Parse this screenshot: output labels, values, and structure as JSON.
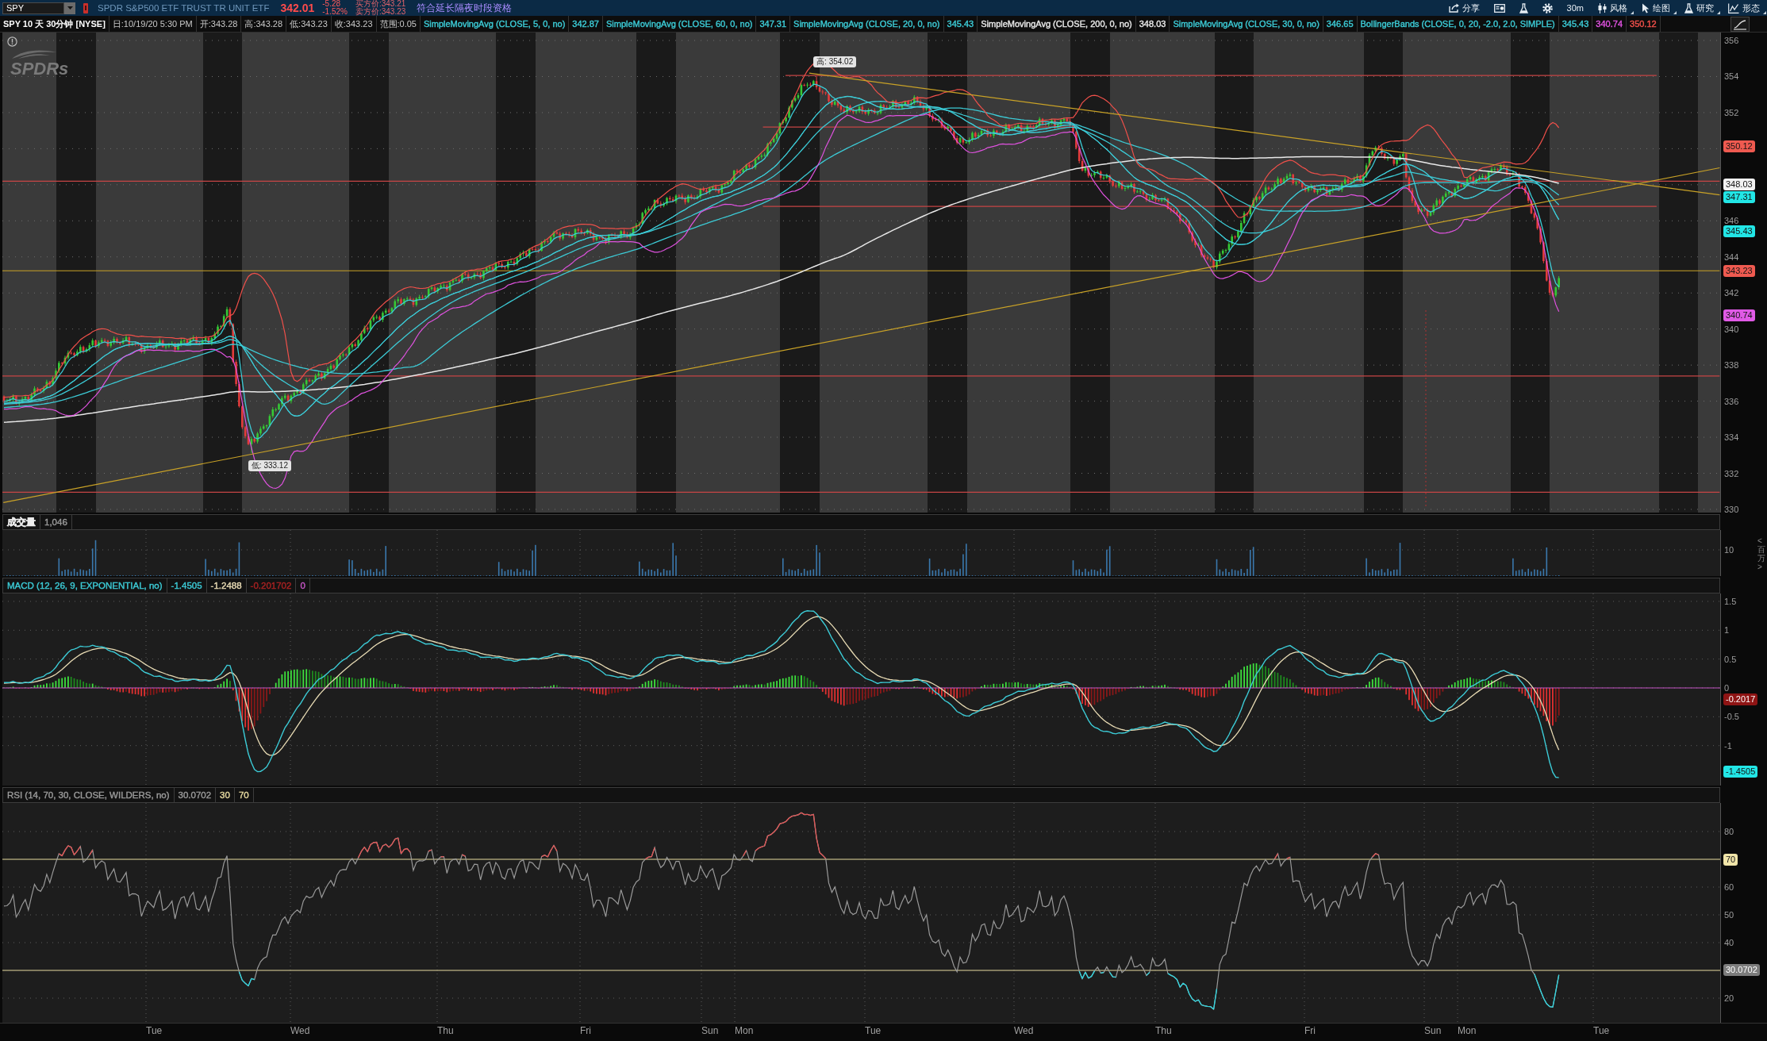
{
  "toolbar": {
    "symbol": "SPY",
    "description": "SPDR S&P500 ETF TRUST TR UNIT ETF",
    "last_price": "342.01",
    "change": "-5.28",
    "change_percent": "-1.52%",
    "bid": "买方价:343.21",
    "ask": "卖方价:343.23",
    "overnight_label": "符合延长隔夜时段资格",
    "buttons": [
      {
        "kind": "share",
        "label": "分享",
        "menu": false
      },
      {
        "kind": "news",
        "menu": false
      },
      {
        "kind": "lab",
        "menu": false
      },
      {
        "kind": "settings",
        "menu": false
      },
      {
        "kind": "timeframe",
        "label": "30m",
        "menu": false
      },
      {
        "kind": "style",
        "label": "风格",
        "menu": true
      },
      {
        "kind": "drawing",
        "label": "绘图",
        "menu": true
      },
      {
        "kind": "studies",
        "label": "研究",
        "menu": true
      },
      {
        "kind": "patterns",
        "label": "形态",
        "menu": true
      }
    ]
  },
  "chart_header": {
    "title": "SPY 10 天 30分钟 [NYSE]",
    "fields": [
      "日:10/19/20 5:30 PM",
      "开:343.28",
      "高:343.28",
      "低:343.23",
      "收:343.23",
      "范围:0.05"
    ],
    "studies": [
      {
        "kind": "sma",
        "label": "SimpleMovingAvg (CLOSE, 5, 0, no)",
        "color": "#3ccbd6",
        "values": [
          {
            "text": "342.87",
            "color": "#3ccbd6"
          }
        ]
      },
      {
        "kind": "sma",
        "label": "SimpleMovingAvg (CLOSE, 60, 0, no)",
        "color": "#3ccbd6",
        "values": [
          {
            "text": "347.31",
            "color": "#3ccbd6"
          }
        ]
      },
      {
        "kind": "sma",
        "label": "SimpleMovingAvg (CLOSE, 20, 0, no)",
        "color": "#3ccbd6",
        "values": [
          {
            "text": "345.43",
            "color": "#3ccbd6"
          }
        ]
      },
      {
        "kind": "sma",
        "label": "SimpleMovingAvg (CLOSE, 200, 0, no)",
        "color": "#e8e8e8",
        "values": [
          {
            "text": "348.03",
            "color": "#e8e8e8"
          }
        ]
      },
      {
        "kind": "sma",
        "label": "SimpleMovingAvg (CLOSE, 30, 0, no)",
        "color": "#3ccbd6",
        "values": [
          {
            "text": "346.65",
            "color": "#3ccbd6"
          }
        ]
      },
      {
        "kind": "bollinger",
        "label": "BollingerBands (CLOSE, 0, 20, -2.0, 2.0, SIMPLE)",
        "color": "#3ccbd6",
        "values": [
          {
            "text": "345.43",
            "color": "#3ccbd6"
          },
          {
            "text": "340.74",
            "color": "#e052e0"
          },
          {
            "text": "350.12",
            "color": "#f0504a"
          }
        ]
      }
    ]
  },
  "price_pane": {
    "logo": "SPDRs",
    "high_label": "高: 354.02",
    "low_label": "低: 333.12",
    "ticks": [
      "356",
      "354",
      "352",
      "346",
      "344",
      "342",
      "340",
      "338",
      "336",
      "334",
      "332",
      "330"
    ],
    "badges": [
      {
        "text": "350.12",
        "color": "#ef5a50"
      },
      {
        "text": "348.03",
        "color": "#f2f2f2"
      },
      {
        "text": "347.31",
        "color": "#22e6e6"
      },
      {
        "text": "345.43",
        "color": "#22e6e6"
      },
      {
        "text": "343.23",
        "color": "#ef5a50"
      },
      {
        "text": "340.74",
        "color": "#e05ae6"
      }
    ]
  },
  "volume_pane": {
    "label": "成交量",
    "color": "#ececec",
    "values": [
      {
        "text": "1,046",
        "color": "#9a9a9a"
      }
    ],
    "ticks": [
      "10"
    ],
    "unit": "<百万>"
  },
  "macd_pane": {
    "label": "MACD (12, 26, 9, EXPONENTIAL, no)",
    "color": "#3ccbd6",
    "values": [
      {
        "text": "-1.4505",
        "color": "#3ccbd6"
      },
      {
        "text": "-1.2488",
        "color": "#e8dbb4"
      },
      {
        "text": "-0.201702",
        "color": "#a82222"
      },
      {
        "text": "0",
        "color": "#c455c4"
      }
    ],
    "ticks": [
      "1.5",
      "1",
      "0.5",
      "0",
      "-0.5",
      "-1"
    ],
    "badges": [
      {
        "text": "-0.2017",
        "color": "#8e1414"
      },
      {
        "text": "-1.4505",
        "color": "#22e6e6"
      }
    ]
  },
  "rsi_pane": {
    "label": "RSI (14, 70, 30, CLOSE, WILDERS, no)",
    "color": "#9a9a9a",
    "values": [
      {
        "text": "30.0702",
        "color": "#9a9a9a"
      },
      {
        "text": "30",
        "color": "#e8dba0"
      },
      {
        "text": "70",
        "color": "#e8dba0"
      }
    ],
    "ticks": [
      "80",
      "60",
      "50",
      "40",
      "20"
    ],
    "badges": [
      {
        "text": "70",
        "color": "#f0e4a8"
      },
      {
        "text": "30.0702",
        "color": "#7c7c7c"
      }
    ]
  },
  "time_axis": [
    "Tue",
    "Wed",
    "Thu",
    "Fri",
    "Sun",
    "Mon",
    "Tue",
    "Wed",
    "Thu",
    "Fri",
    "Sun",
    "Mon",
    "Tue"
  ]
}
